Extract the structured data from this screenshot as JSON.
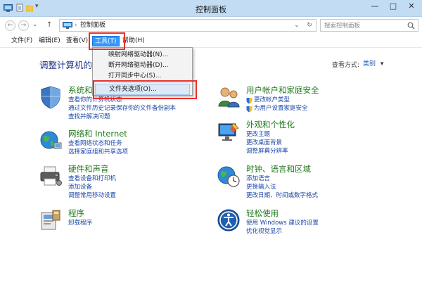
{
  "window": {
    "title": "控制面板",
    "controls": {
      "minimize": "—",
      "maximize": "□",
      "close": "✕"
    }
  },
  "address_bar": {
    "breadcrumb": [
      "控制面板"
    ],
    "search_placeholder": "搜索控制面板",
    "nav": {
      "back": "←",
      "forward": "→",
      "recent": "⌄",
      "up": "↑",
      "dropdown": "⌄",
      "refresh": "↻"
    }
  },
  "menu": {
    "items": [
      "文件(F)",
      "编辑(E)",
      "查看(V)",
      "工具(T)",
      "帮助(H)"
    ],
    "active_index": 3
  },
  "tools_menu": {
    "items": [
      "映射网络驱动器(N)...",
      "断开网络驱动器(D)...",
      "打开同步中心(S)...",
      "文件夹选项(O)..."
    ],
    "highlighted_index": 3
  },
  "content": {
    "heading": "调整计算机的设置",
    "view_by": {
      "label": "查看方式:",
      "value": "类别",
      "arrow": "▾"
    },
    "categories": [
      {
        "title": "系统和安全",
        "links": [
          "查看你的计算机状态",
          "通过文件历史记录保存你的文件备份副本",
          "查找并解决问题"
        ]
      },
      {
        "title": "网络和 Internet",
        "links": [
          "查看网络状态和任务",
          "选择家庭组和共享选项"
        ]
      },
      {
        "title": "硬件和声音",
        "links": [
          "查看设备和打印机",
          "添加设备",
          "调整常用移动设置"
        ]
      },
      {
        "title": "程序",
        "links": [
          "卸载程序"
        ]
      },
      {
        "title": "用户帐户和家庭安全",
        "links": [
          "更改帐户类型",
          "为用户设置家庭安全"
        ]
      },
      {
        "title": "外观和个性化",
        "links": [
          "更改主题",
          "更改桌面背景",
          "调整屏幕分辨率"
        ]
      },
      {
        "title": "时钟、语言和区域",
        "links": [
          "添加语言",
          "更换输入法",
          "更改日期、时间或数字格式"
        ]
      },
      {
        "title": "轻松使用",
        "links": [
          "使用 Windows 建议的设置",
          "优化视觉显示"
        ]
      }
    ]
  },
  "colors": {
    "titlebar": "#c2dcf4",
    "heading": "#1e3287",
    "category_title": "#1f7a1a",
    "link": "#1c47a8",
    "menu_active": "#3399ff",
    "annotation_box": "#e8312e"
  },
  "icons": [
    "control-panel-icon",
    "back-icon",
    "forward-icon",
    "up-icon",
    "refresh-icon",
    "search-icon",
    "security-shield-icon",
    "network-globe-icon",
    "printer-icon",
    "programs-icon",
    "users-icon",
    "appearance-icon",
    "clock-globe-icon",
    "ease-of-access-icon",
    "uac-shield-icon"
  ]
}
